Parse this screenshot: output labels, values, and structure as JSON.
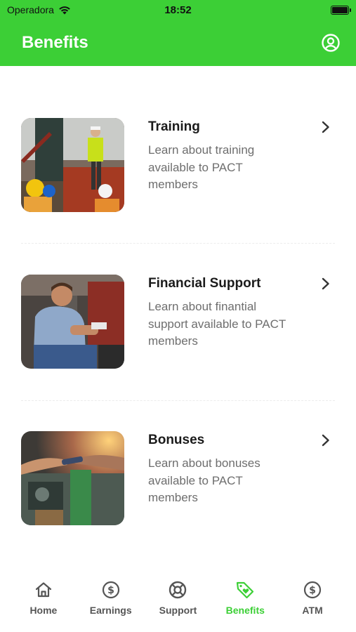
{
  "status_bar": {
    "carrier": "Operadora",
    "time": "18:52"
  },
  "header": {
    "title": "Benefits"
  },
  "benefits": [
    {
      "title": "Training",
      "description": "Learn about training available to PACT members",
      "image": "construction-training-photo"
    },
    {
      "title": "Financial Support",
      "description": "Learn about finantial support available to PACT members",
      "image": "factory-worker-photo"
    },
    {
      "title": "Bonuses",
      "description": "Learn about bonuses available to PACT members",
      "image": "handshake-factory-photo"
    }
  ],
  "tabs": [
    {
      "label": "Home",
      "icon": "home-icon",
      "active": false
    },
    {
      "label": "Earnings",
      "icon": "dollar-circle-icon",
      "active": false
    },
    {
      "label": "Support",
      "icon": "lifebuoy-icon",
      "active": false
    },
    {
      "label": "Benefits",
      "icon": "tag-heart-icon",
      "active": true
    },
    {
      "label": "ATM",
      "icon": "dollar-circle-icon",
      "active": false
    }
  ],
  "colors": {
    "brand": "#3ccf36",
    "text": "#1b1b1b",
    "muted": "#6e6e6e",
    "tab_inactive": "#555555"
  }
}
